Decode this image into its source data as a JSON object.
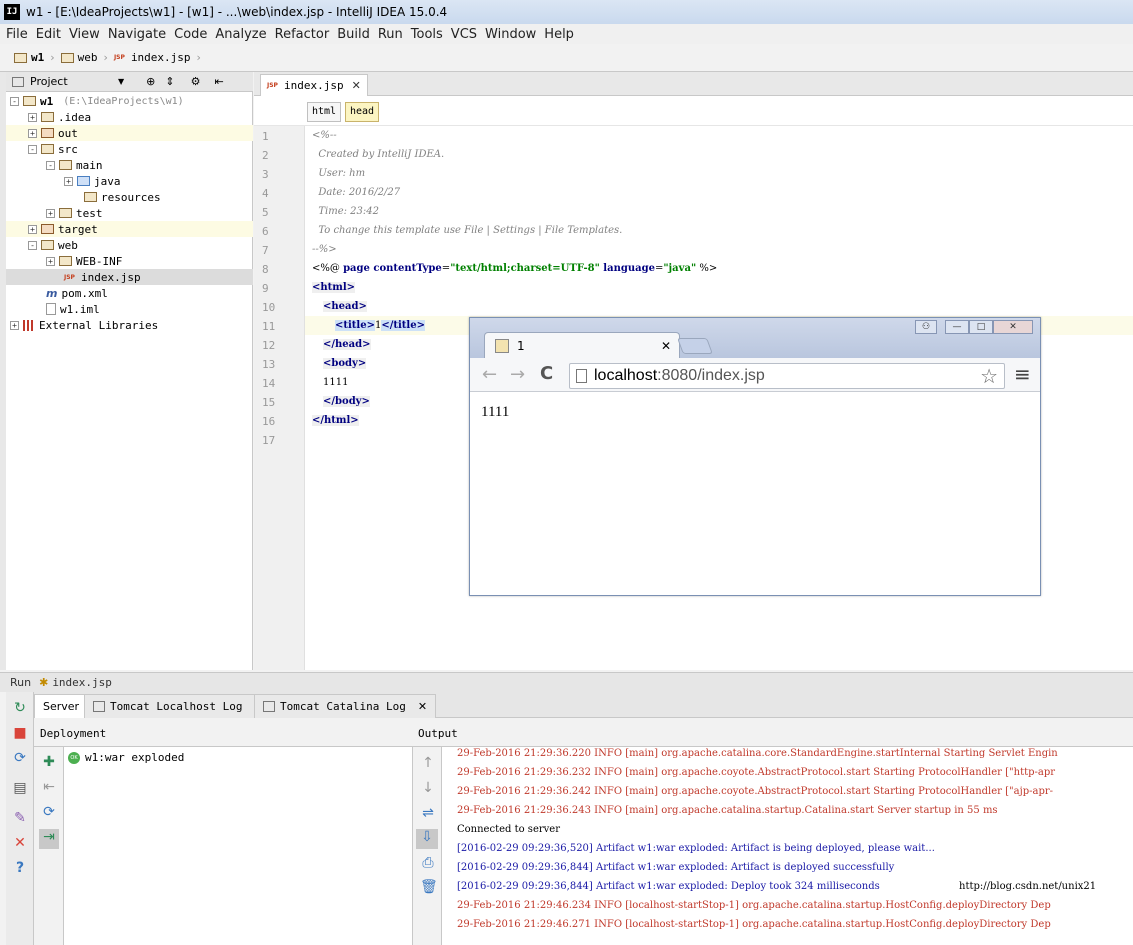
{
  "window": {
    "title": "w1 - [E:\\IdeaProjects\\w1] - [w1] - ...\\web\\index.jsp - IntelliJ IDEA 15.0.4",
    "logo": "IJ"
  },
  "menu": [
    "File",
    "Edit",
    "View",
    "Navigate",
    "Code",
    "Analyze",
    "Refactor",
    "Build",
    "Run",
    "Tools",
    "VCS",
    "Window",
    "Help"
  ],
  "nav": {
    "crumbs": [
      "w1",
      "web",
      "index.jsp"
    ]
  },
  "project_panel": {
    "title": "Project",
    "tree": [
      {
        "label": "w1",
        "path": "(E:\\IdeaProjects\\w1)",
        "expanded": "-",
        "icon": "module-icon"
      },
      {
        "label": ".idea",
        "expanded": "+",
        "icon": "folder-icon"
      },
      {
        "label": "out",
        "expanded": "+",
        "icon": "folder-excluded-icon"
      },
      {
        "label": "src",
        "expanded": "-",
        "icon": "folder-icon"
      },
      {
        "label": "main",
        "expanded": "-",
        "icon": "folder-icon"
      },
      {
        "label": "java",
        "expanded": "+",
        "icon": "source-folder-icon"
      },
      {
        "label": "resources",
        "expanded": "",
        "icon": "resources-folder-icon"
      },
      {
        "label": "test",
        "expanded": "+",
        "icon": "folder-icon"
      },
      {
        "label": "target",
        "expanded": "+",
        "icon": "folder-excluded-icon"
      },
      {
        "label": "web",
        "expanded": "-",
        "icon": "web-folder-icon"
      },
      {
        "label": "WEB-INF",
        "expanded": "+",
        "icon": "folder-icon"
      },
      {
        "label": "index.jsp",
        "expanded": "",
        "icon": "jsp-file-icon"
      },
      {
        "label": "pom.xml",
        "expanded": "",
        "icon": "maven-icon"
      },
      {
        "label": "w1.iml",
        "expanded": "",
        "icon": "iml-file-icon"
      },
      {
        "label": "External Libraries",
        "expanded": "+",
        "icon": "libraries-icon"
      }
    ]
  },
  "editor": {
    "tab": "index.jsp",
    "breadcrumbs": [
      "html",
      "head"
    ],
    "line_numbers": [
      "1",
      "2",
      "3",
      "4",
      "5",
      "6",
      "7",
      "8",
      "9",
      "10",
      "11",
      "12",
      "13",
      "14",
      "15",
      "16",
      "17"
    ],
    "lines": {
      "l1": "<%--",
      "l2": "  Created by IntelliJ IDEA.",
      "l3": "  User: hm",
      "l4": "  Date: 2016/2/27",
      "l5": "  Time: 23:42",
      "l6": "  To change this template use File | Settings | File Templates.",
      "l7": "--%>",
      "l8a": "<%@ ",
      "l8b": "page ",
      "l8c": "contentType",
      "l8d": "=",
      "l8e": "\"text/html;charset=UTF-8\"",
      "l8f": " language",
      "l8g": "=",
      "l8h": "\"java\"",
      "l8i": " %>",
      "l9": "<html>",
      "l10": "<head>",
      "l11a": "<title>",
      "l11b": "1",
      "l11c": "</title>",
      "l12": "</head>",
      "l13": "<body>",
      "l14": "1111",
      "l15": "</body>",
      "l16": "</html>"
    }
  },
  "browser": {
    "tab_title": "1",
    "url_host": "localhost",
    "url_path": ":8080/index.jsp",
    "content": "1111",
    "back": "←",
    "forward": "→",
    "reload": "C",
    "star": "☆",
    "menu": "≡",
    "win_user": "⚇",
    "win_min": "—",
    "win_max": "□",
    "win_close": "✕"
  },
  "run": {
    "label": "Run",
    "config": "index.jsp",
    "tabs": [
      "Server",
      "Tomcat Localhost Log",
      "Tomcat Catalina Log"
    ],
    "deployment_header": "Deployment",
    "deployment_item": "w1:war exploded",
    "output_header": "Output",
    "log": [
      {
        "text": "29-Feb-2016 21:29:36.220 INFO [main] org.apache.catalina.core.StandardEngine.startInternal Starting Servlet Engin",
        "color": "red"
      },
      {
        "text": "29-Feb-2016 21:29:36.232 INFO [main] org.apache.coyote.AbstractProtocol.start Starting ProtocolHandler [\"http-apr",
        "color": "red"
      },
      {
        "text": "29-Feb-2016 21:29:36.242 INFO [main] org.apache.coyote.AbstractProtocol.start Starting ProtocolHandler [\"ajp-apr-",
        "color": "red"
      },
      {
        "text": "29-Feb-2016 21:29:36.243 INFO [main] org.apache.catalina.startup.Catalina.start Server startup in 55 ms",
        "color": "red"
      },
      {
        "text": "Connected to server",
        "color": "blk"
      },
      {
        "text": "[2016-02-29 09:29:36,520] Artifact w1:war exploded: Artifact is being deployed, please wait...",
        "color": "blue"
      },
      {
        "text": "[2016-02-29 09:29:36,844] Artifact w1:war exploded: Artifact is deployed successfully",
        "color": "blue"
      },
      {
        "text": "[2016-02-29 09:29:36,844] Artifact w1:war exploded: Deploy took 324 milliseconds",
        "color": "blue",
        "extra": "http://blog.csdn.net/unix21"
      },
      {
        "text": "29-Feb-2016 21:29:46.234 INFO [localhost-startStop-1] org.apache.catalina.startup.HostConfig.deployDirectory Dep",
        "color": "red"
      },
      {
        "text": "29-Feb-2016 21:29:46.271 INFO [localhost-startStop-1] org.apache.catalina.startup.HostConfig.deployDirectory Dep",
        "color": "red"
      }
    ]
  }
}
